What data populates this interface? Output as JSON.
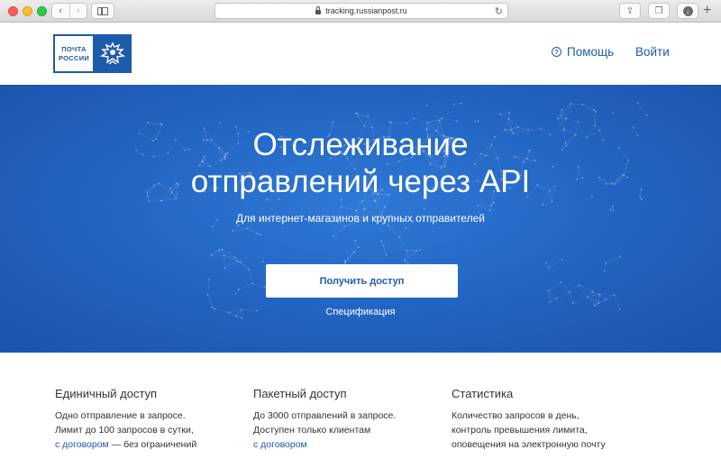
{
  "browser": {
    "url": "tracking.russianpost.ru",
    "back_glyph": "‹",
    "forward_glyph": "›",
    "reload_glyph": "↻",
    "share_glyph": "⇪",
    "tabs_glyph": "❐",
    "download_glyph": "↓",
    "new_tab_glyph": "+"
  },
  "header": {
    "logo_line1": "ПОЧТА",
    "logo_line2": "РОССИИ",
    "help_icon_glyph": "?",
    "help_label": "Помощь",
    "login_label": "Войти",
    "brand_color": "#1e5bab"
  },
  "hero": {
    "title_line1": "Отслеживание",
    "title_line2": "отправлений через API",
    "subtitle": "Для интернет-магазинов и крупных отправителей",
    "cta_label": "Получить доступ",
    "spec_link": "Спецификация",
    "background_color": "#2466c4"
  },
  "features": [
    {
      "title": "Единичный доступ",
      "line1": "Одно отправление в запросе.",
      "line2": "Лимит до 100 запросов в сутки,",
      "link": "с договором",
      "line3_rest": " — без ограничений"
    },
    {
      "title": "Пакетный доступ",
      "line1": "До 3000 отправлений в запросе.",
      "line2": "Доступен только клиентам",
      "link": "с договором"
    },
    {
      "title": "Статистика",
      "line1": "Количество запросов в день,",
      "line2": "контроль превышения лимита,",
      "line3": "оповещения на электронную почту"
    }
  ]
}
